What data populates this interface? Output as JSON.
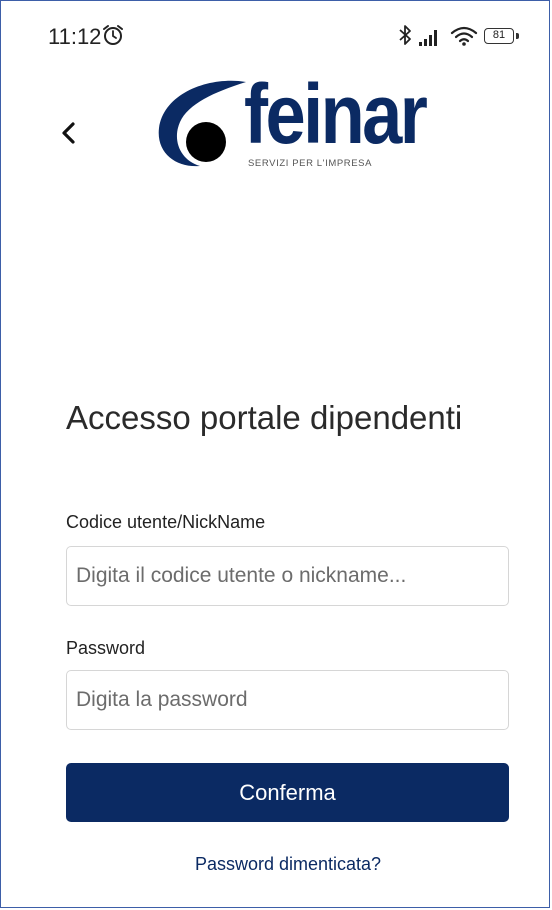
{
  "status_bar": {
    "time": "11:12",
    "battery_level": "81",
    "icons": [
      "alarm-icon",
      "bluetooth-icon",
      "signal-icon",
      "wifi-icon",
      "battery-icon"
    ]
  },
  "header": {
    "back_icon": "chevron-left-icon",
    "logo": {
      "name": "feinar",
      "tagline": "SERVIZI PER L'IMPRESA"
    }
  },
  "form": {
    "title": "Accesso portale dipendenti",
    "user_field": {
      "label": "Codice utente/NickName",
      "placeholder": "Digita il codice utente o nickname...",
      "value": ""
    },
    "password_field": {
      "label": "Password",
      "placeholder": "Digita la password",
      "value": ""
    },
    "confirm_label": "Conferma",
    "forgot_label": "Password dimenticata?"
  },
  "colors": {
    "brand_navy": "#0b2a63",
    "background": "#ffffff",
    "input_border": "#d6d6d6"
  }
}
